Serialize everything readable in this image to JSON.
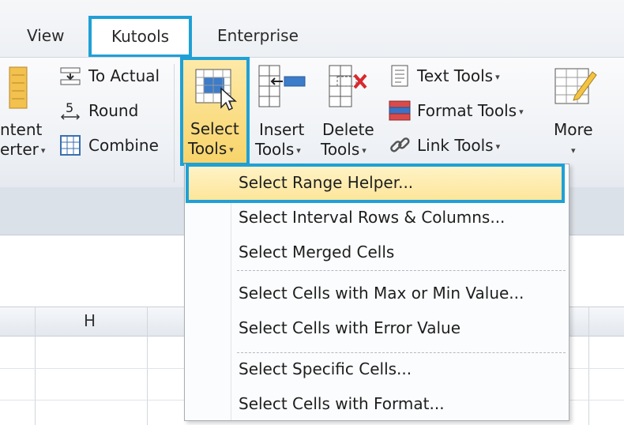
{
  "tabs": {
    "view": "View",
    "kutools": "Kutools",
    "enterprise": "Enterprise"
  },
  "ribbon": {
    "content_converter_line1": "ntent",
    "content_converter_line2": "erter",
    "to_actual": "To Actual",
    "round": "Round",
    "combine": "Combine",
    "select_tools_line1": "Select",
    "select_tools_line2": "Tools",
    "insert_tools_line1": "Insert",
    "insert_tools_line2": "Tools",
    "delete_tools_line1": "Delete",
    "delete_tools_line2": "Tools",
    "text_tools": "Text Tools",
    "format_tools": "Format Tools",
    "link_tools": "Link Tools",
    "more": "More",
    "caret": "▾"
  },
  "sheet": {
    "column_h": "H"
  },
  "menu": {
    "items": [
      "Select Range Helper...",
      "Select Interval Rows & Columns...",
      "Select Merged Cells",
      "Select Cells with Max or Min Value...",
      "Select Cells with Error Value",
      "Select Specific Cells...",
      "Select Cells with Format..."
    ]
  },
  "colors": {
    "highlight_border": "#1fa0d6",
    "hover_fill": "#fde59a"
  }
}
